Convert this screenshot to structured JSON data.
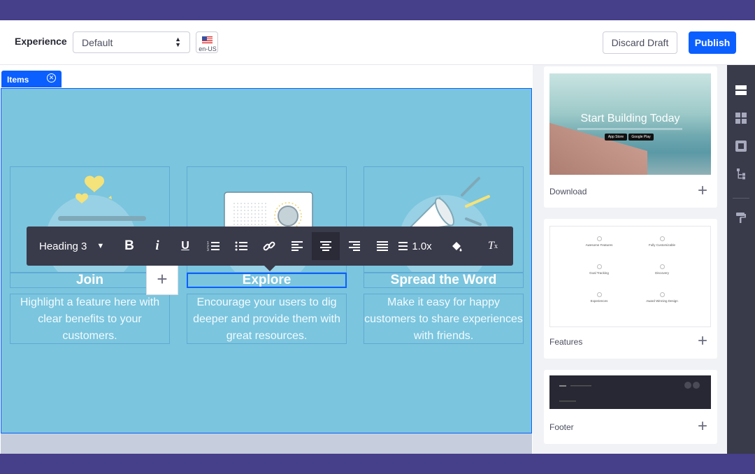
{
  "header": {
    "experience_label": "Experience",
    "experience_value": "Default",
    "locale": "en-US",
    "discard_label": "Discard Draft",
    "publish_label": "Publish"
  },
  "canvas": {
    "items_tab_label": "Items",
    "columns": [
      {
        "title": "Join",
        "description_lines": [
          "Highlight a feature here with",
          "clear benefits to your",
          "customers."
        ]
      },
      {
        "title": "Explore",
        "description_lines": [
          "Encourage your users to dig",
          "deeper and provide them with",
          "great resources."
        ]
      },
      {
        "title": "Spread the Word",
        "description_lines": [
          "Make it easy for happy",
          "customers to share experiences",
          "with friends."
        ]
      }
    ],
    "add_label": "+"
  },
  "toolbar": {
    "heading_select": "Heading 3",
    "line_height": "1.0x",
    "buttons": [
      "bold",
      "italic",
      "underline",
      "ordered-list",
      "unordered-list",
      "link",
      "align-left",
      "align-center",
      "align-right",
      "justify",
      "line-height",
      "text-color",
      "clear-format"
    ],
    "active_button": "align-center"
  },
  "sidebar": {
    "fragments": [
      {
        "name": "Download",
        "thumb_title": "Start Building Today",
        "store_buttons": [
          "App Store",
          "Google Play"
        ]
      },
      {
        "name": "Features",
        "items": [
          "Awesome Features",
          "Fully Customizable",
          "Goal Tracking",
          "Discovery",
          "Experiences",
          "Award Winning Design"
        ]
      },
      {
        "name": "Footer"
      }
    ],
    "add_label": "+"
  },
  "rail": {
    "icons": [
      "fragments-icon",
      "widgets-icon",
      "page-structure-icon",
      "tree-icon",
      "paint-roller-icon"
    ]
  },
  "colors": {
    "brand": "#0b5fff",
    "section_bg": "#7bc5de",
    "toolbar_bg": "#393a4a",
    "frame_bg": "#463f8a"
  }
}
